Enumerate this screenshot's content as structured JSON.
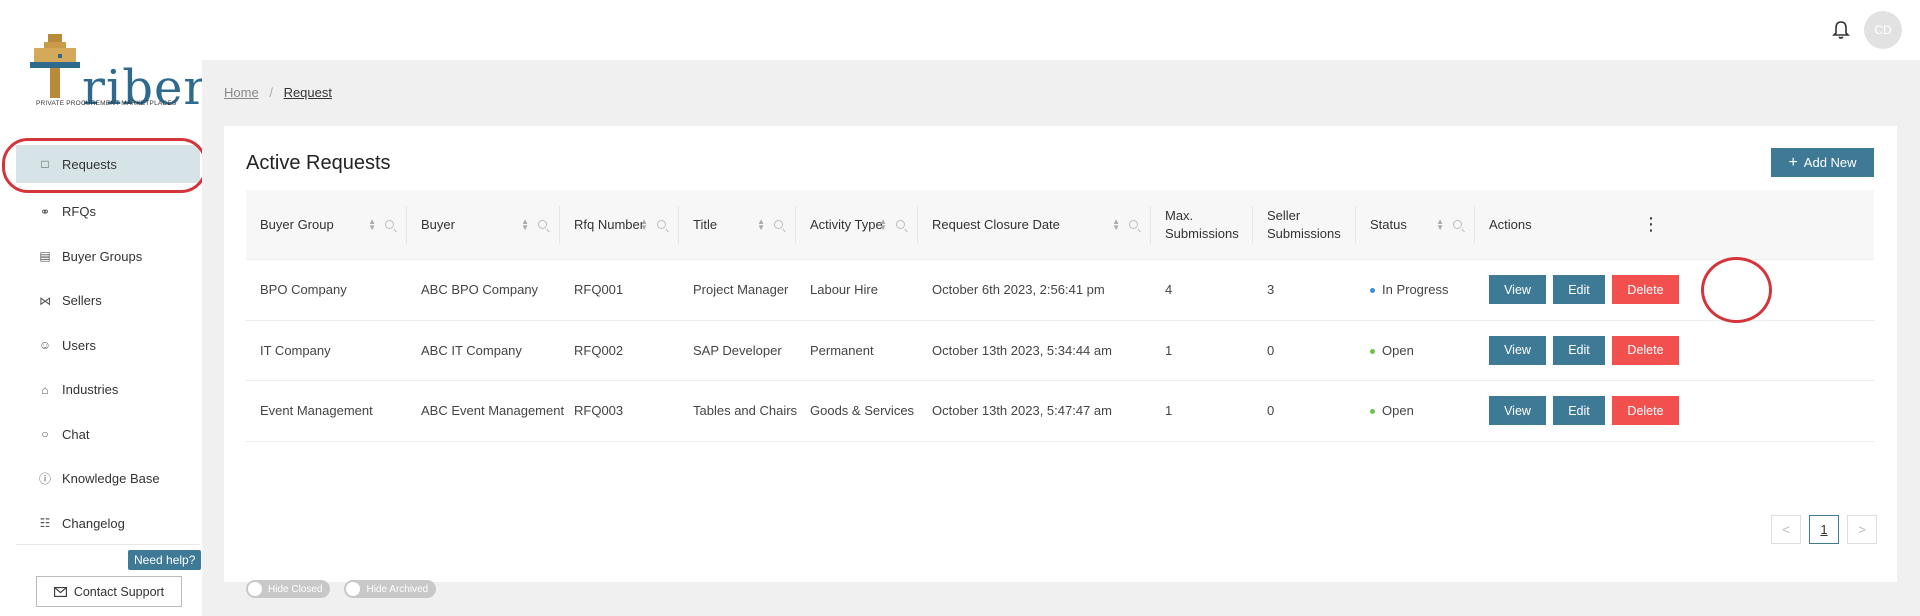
{
  "header": {
    "avatar_initials": "CD",
    "bell_icon": "bell-icon"
  },
  "brand": {
    "logo_text": "riber",
    "tagline": "PRIVATE PROCUREMENT MARKETPLACES"
  },
  "sidebar": {
    "items": [
      {
        "label": "Requests",
        "icon": "document-icon",
        "active": true
      },
      {
        "label": "RFQs",
        "icon": "link-icon"
      },
      {
        "label": "Buyer Groups",
        "icon": "building-icon"
      },
      {
        "label": "Sellers",
        "icon": "sitemap-icon"
      },
      {
        "label": "Users",
        "icon": "users-icon"
      },
      {
        "label": "Industries",
        "icon": "bank-icon"
      },
      {
        "label": "Chat",
        "icon": "chat-icon"
      },
      {
        "label": "Knowledge Base",
        "icon": "help-icon"
      },
      {
        "label": "Changelog",
        "icon": "clipboard-icon"
      }
    ],
    "need_help": "Need help?",
    "contact_support": "Contact Support"
  },
  "breadcrumb": {
    "home": "Home",
    "separator": "/",
    "current": "Request"
  },
  "main": {
    "title": "Active Requests",
    "add_button": "Add New",
    "table": {
      "columns": [
        "Buyer Group",
        "Buyer",
        "Rfq Number",
        "Title",
        "Activity Type",
        "Request Closure Date",
        "Max. Submissions",
        "Seller Submissions",
        "Status",
        "Actions"
      ],
      "rows": [
        {
          "buyer_group": "BPO Company",
          "buyer": "ABC BPO Company",
          "rfq": "RFQ001",
          "title": "Project Manager",
          "activity": "Labour Hire",
          "closure": "October 6th 2023, 2:56:41 pm",
          "max": "4",
          "seller": "3",
          "status": "In Progress",
          "status_color": "#3e8fd6"
        },
        {
          "buyer_group": "IT Company",
          "buyer": "ABC IT Company",
          "rfq": "RFQ002",
          "title": "SAP Developer",
          "activity": "Permanent",
          "closure": "October 13th 2023, 5:34:44 am",
          "max": "1",
          "seller": "0",
          "status": "Open",
          "status_color": "#6cc24a"
        },
        {
          "buyer_group": "Event Management",
          "buyer": "ABC Event Management",
          "rfq": "RFQ003",
          "title": "Tables and Chairs",
          "activity": "Goods & Services",
          "closure": "October 13th 2023, 5:47:47 am",
          "max": "1",
          "seller": "0",
          "status": "Open",
          "status_color": "#6cc24a"
        }
      ],
      "actions": {
        "view": "View",
        "edit": "Edit",
        "delete": "Delete"
      }
    },
    "pagination": {
      "prev": "<",
      "current": "1",
      "next": ">"
    },
    "toggles": {
      "hide_closed": "Hide Closed",
      "hide_archived": "Hide Archived"
    }
  },
  "colors": {
    "accent": "#3e7a96",
    "danger": "#f24f4f",
    "annotation": "#d3353a"
  }
}
